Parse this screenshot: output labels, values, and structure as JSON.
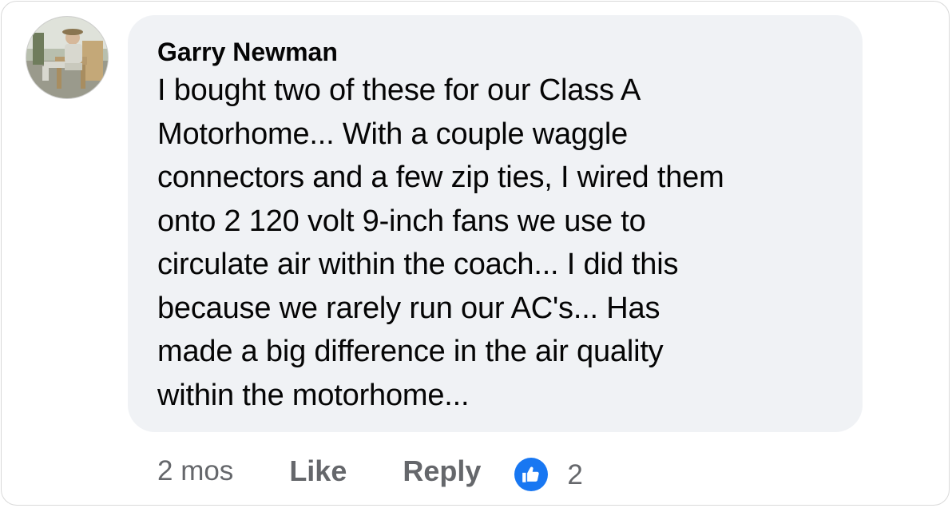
{
  "comment": {
    "author": "Garry Newman",
    "text": "I bought two of these for our Class A\nMotorhome... With a couple waggle\nconnectors and a few zip ties, I wired them\nonto 2 120 volt 9-inch fans we use to\ncirculate air within the coach...  I did this\nbecause we rarely run our AC's...  Has\nmade a big difference in the air quality\nwithin the motorhome...",
    "avatar_icon": "user-avatar-photo"
  },
  "actions": {
    "timestamp": "2 mos",
    "like_label": "Like",
    "reply_label": "Reply"
  },
  "reactions": {
    "icon": "thumbs-up-icon",
    "color": "#1877f2",
    "count": "2"
  }
}
